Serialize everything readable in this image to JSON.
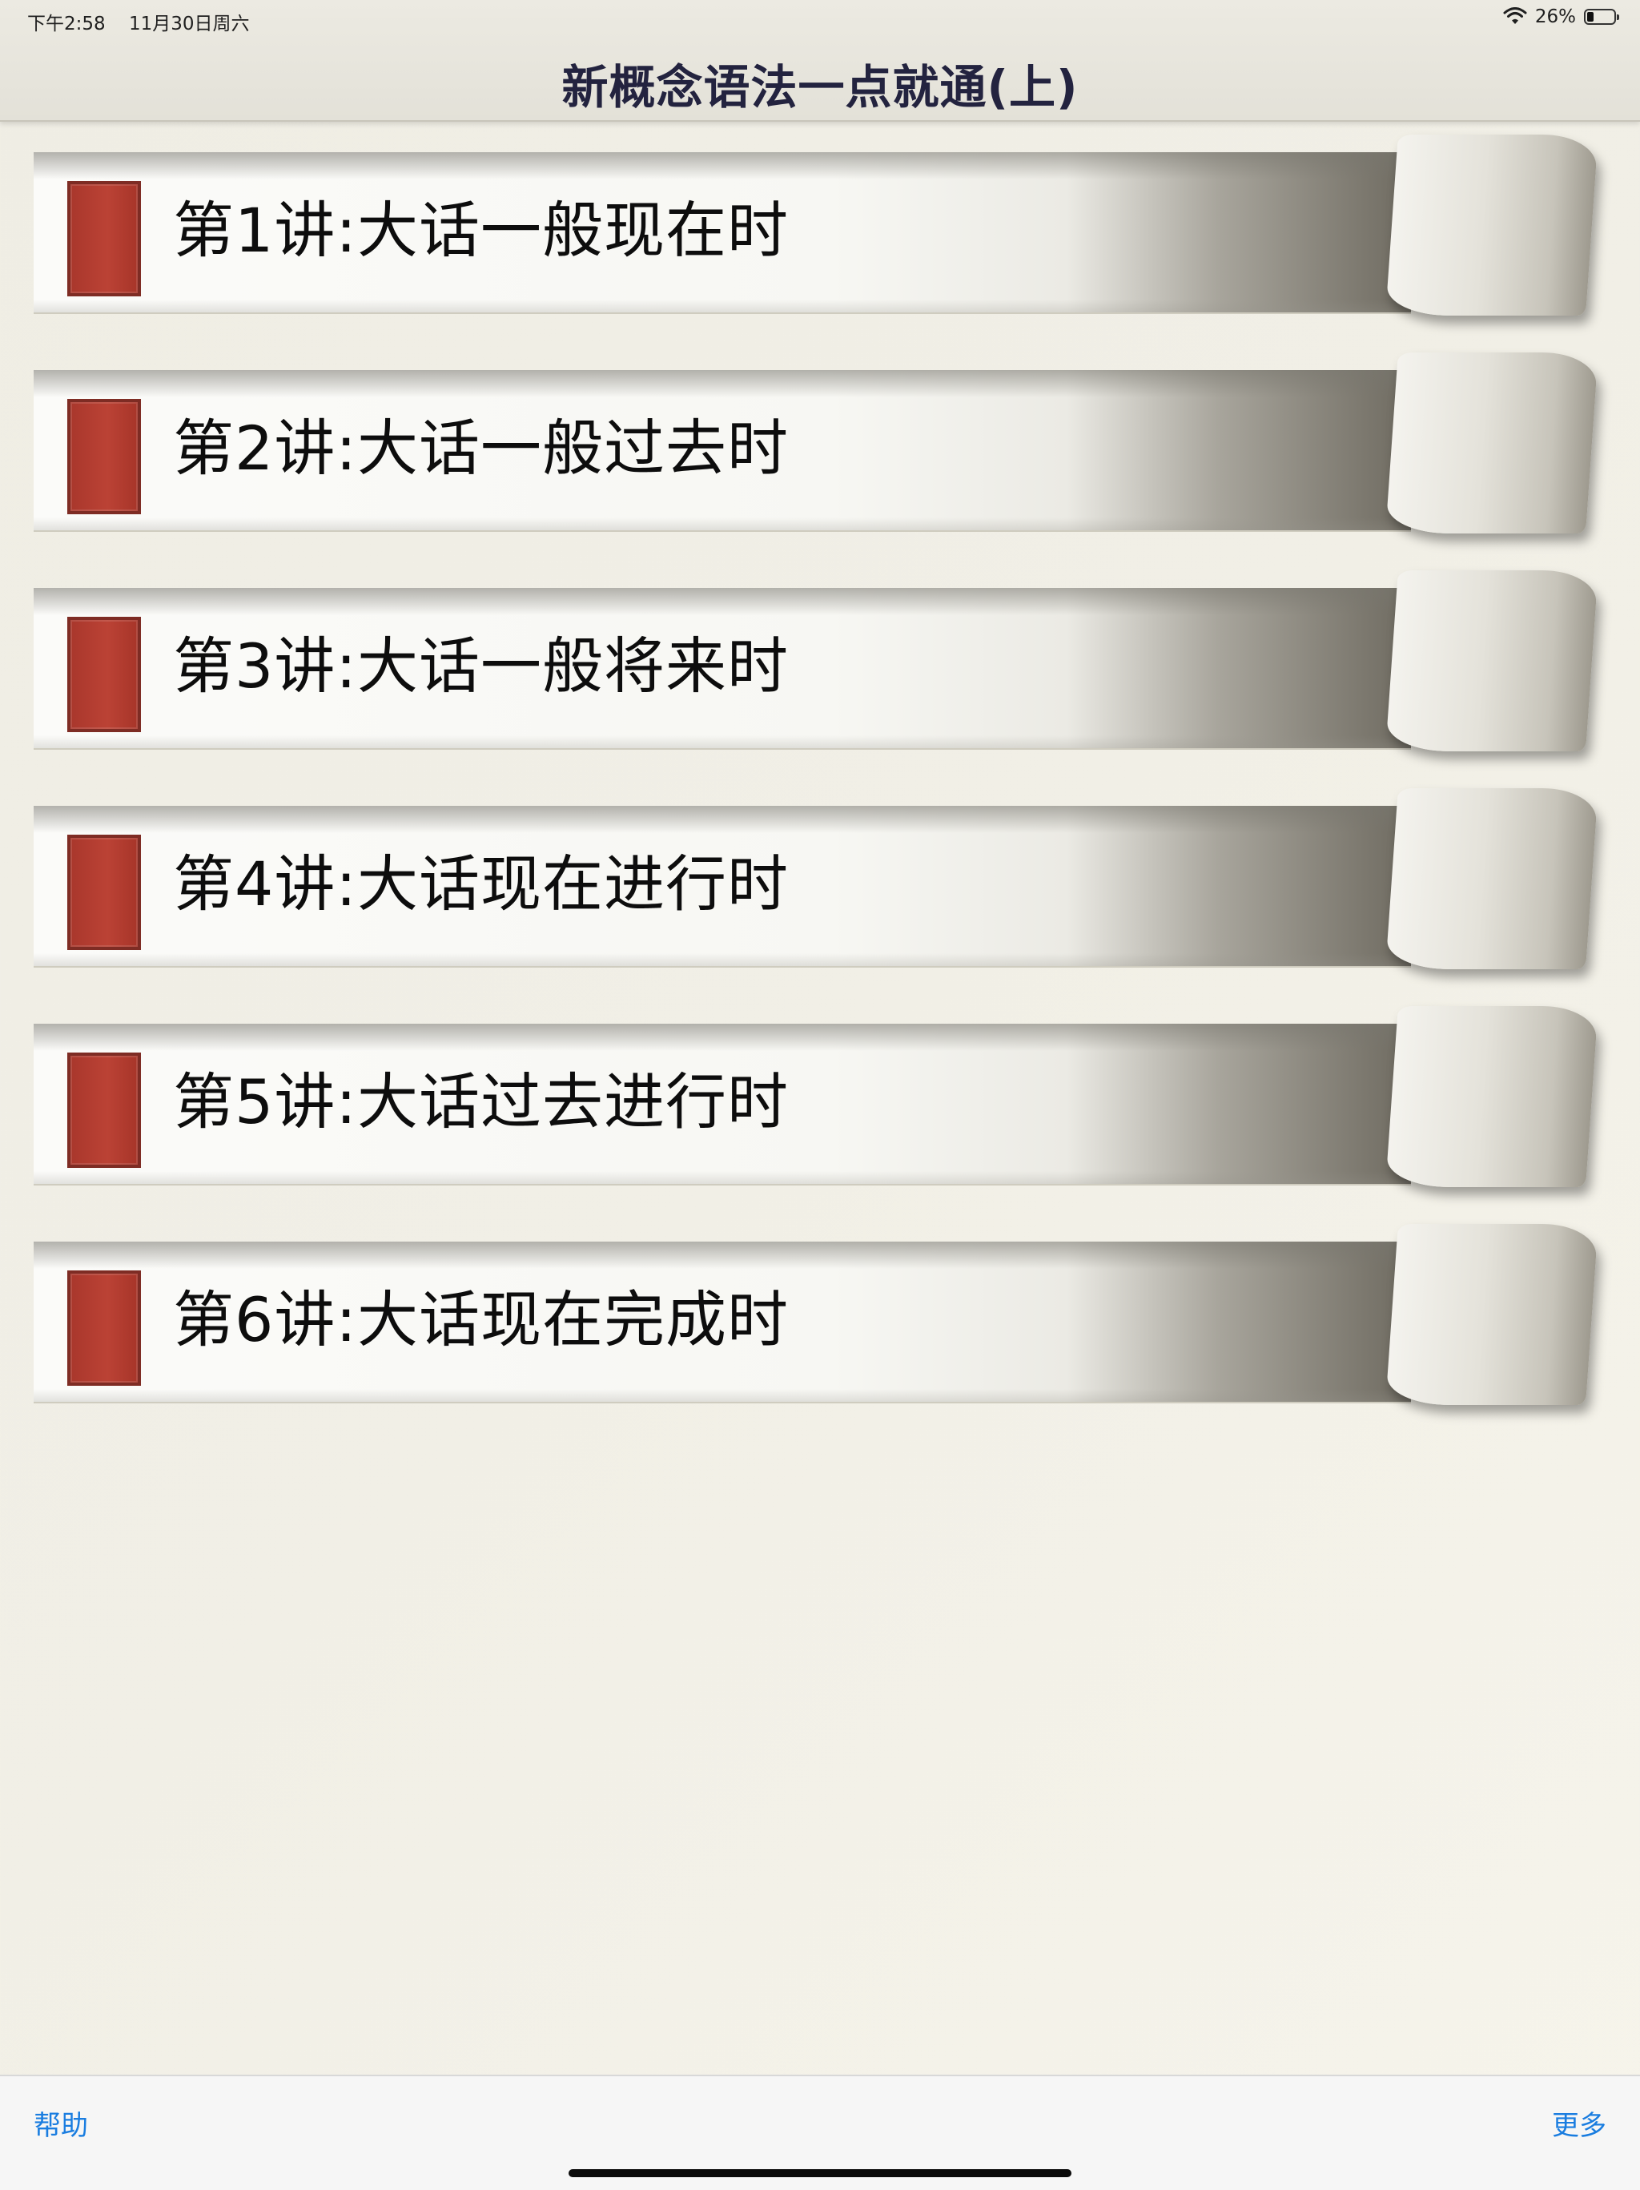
{
  "status_bar": {
    "time": "下午2:58",
    "date": "11月30日周六",
    "battery_percent": "26%",
    "battery_level": 0.26
  },
  "nav": {
    "title": "新概念语法一点就通(上)"
  },
  "lessons": [
    {
      "label": "第1讲:大话一般现在时"
    },
    {
      "label": "第2讲:大话一般过去时"
    },
    {
      "label": "第3讲:大话一般将来时"
    },
    {
      "label": "第4讲:大话现在进行时"
    },
    {
      "label": "第5讲:大话过去进行时"
    },
    {
      "label": "第6讲:大话现在完成时"
    }
  ],
  "toolbar": {
    "help_label": "帮助",
    "more_label": "更多"
  },
  "colors": {
    "accent": "#1a7de0",
    "bookmark": "#b13d31",
    "title": "#23233f"
  }
}
